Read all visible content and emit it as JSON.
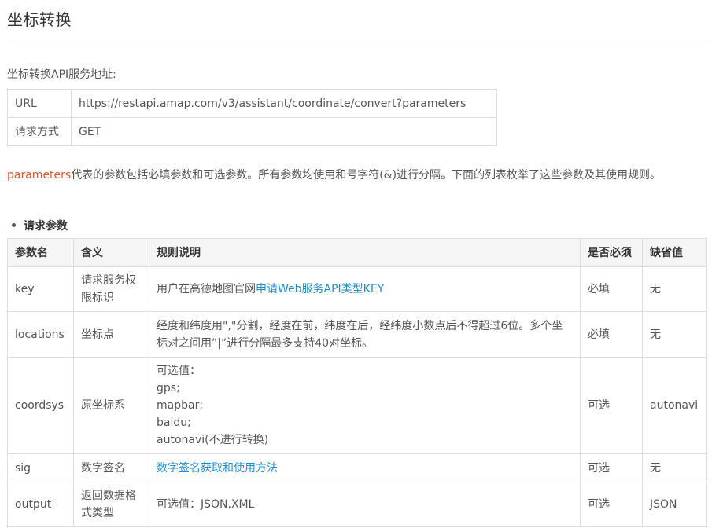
{
  "page": {
    "title": "坐标转换",
    "service_label": "坐标转换API服务地址:"
  },
  "service_table": {
    "rows": [
      {
        "key": "URL",
        "value": "https://restapi.amap.com/v3/assistant/coordinate/convert?parameters"
      },
      {
        "key": "请求方式",
        "value": "GET"
      }
    ]
  },
  "description": {
    "highlight": "parameters",
    "text": "代表的参数包括必填参数和可选参数。所有参数均使用和号字符(&)进行分隔。下面的列表枚举了这些参数及其使用规则。"
  },
  "section": {
    "bullet": "请求参数"
  },
  "params_table": {
    "headers": [
      "参数名",
      "含义",
      "规则说明",
      "是否必须",
      "缺省值"
    ],
    "rows": [
      {
        "name": "key",
        "meaning": "请求服务权限标识",
        "rule_prefix": "用户在高德地图官网",
        "rule_link": "申请Web服务API类型KEY",
        "required": "必填",
        "default": "无"
      },
      {
        "name": "locations",
        "meaning": "坐标点",
        "rule": "经度和纬度用\",\"分割，经度在前，纬度在后，经纬度小数点后不得超过6位。多个坐标对之间用”|”进行分隔最多支持40对坐标。",
        "required": "必填",
        "default": "无"
      },
      {
        "name": "coordsys",
        "meaning": "原坐标系",
        "rule_lines": [
          "可选值：",
          "gps;",
          "mapbar;",
          "baidu;",
          "autonavi(不进行转换)"
        ],
        "required": "可选",
        "default": "autonavi"
      },
      {
        "name": "sig",
        "meaning": "数字签名",
        "rule_link": "数字签名获取和使用方法",
        "required": "可选",
        "default": "无"
      },
      {
        "name": "output",
        "meaning": "返回数据格式类型",
        "rule": "可选值：JSON,XML",
        "required": "可选",
        "default": "JSON"
      }
    ]
  },
  "colors": {
    "highlight": "#e4542c",
    "link": "#1b8fd6",
    "border": "#dddddd",
    "header_bg": "#f5f5f5"
  }
}
